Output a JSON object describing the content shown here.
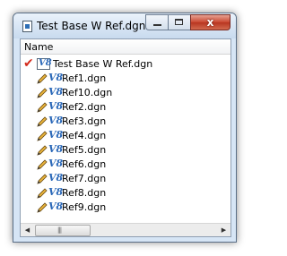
{
  "window": {
    "title": "Test Base W Ref.dgn - Test ...",
    "close_glyph": "x"
  },
  "column_header": "Name",
  "tree": {
    "root": {
      "label": "Test Base W Ref.dgn",
      "icon": "dgn-file-icon",
      "status_icon": "red-check-icon"
    },
    "children": [
      {
        "label": "Ref1.dgn"
      },
      {
        "label": "Ref10.dgn"
      },
      {
        "label": "Ref2.dgn"
      },
      {
        "label": "Ref3.dgn"
      },
      {
        "label": "Ref4.dgn"
      },
      {
        "label": "Ref5.dgn"
      },
      {
        "label": "Ref6.dgn"
      },
      {
        "label": "Ref7.dgn"
      },
      {
        "label": "Ref8.dgn"
      },
      {
        "label": "Ref9.dgn"
      }
    ]
  },
  "scrollbar": {
    "left_arrow": "◀",
    "right_arrow": "▶",
    "grip": "|||"
  },
  "colors": {
    "check": "#d32a1c",
    "v8_icon": "#2a68b8",
    "close_button": "#c9462f"
  }
}
